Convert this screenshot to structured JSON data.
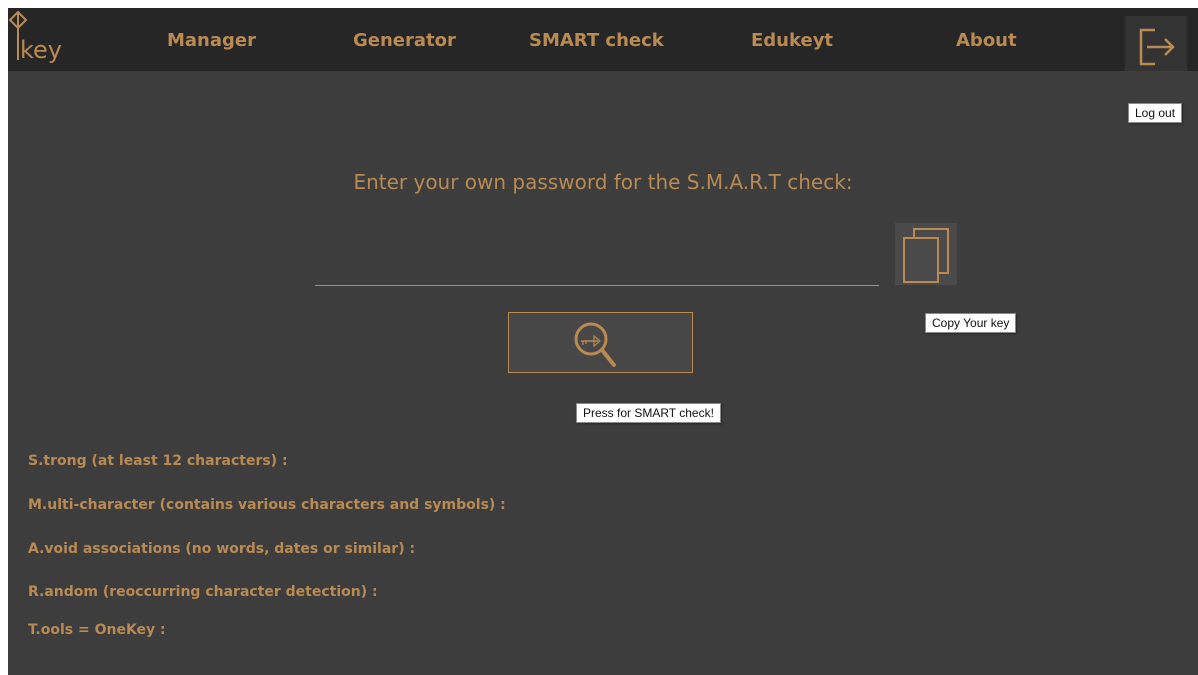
{
  "navbar": {
    "logo_text": "key",
    "items": [
      {
        "label": "Manager"
      },
      {
        "label": "Generator"
      },
      {
        "label": "SMART check"
      },
      {
        "label": "Edukeyt"
      },
      {
        "label": "About"
      }
    ],
    "logout_icon": "logout-icon",
    "logout_tooltip": "Log out"
  },
  "main": {
    "heading": "Enter your own password for the S.M.A.R.T check:",
    "password_input": {
      "value": "",
      "placeholder": ""
    },
    "copy_icon": "copy-icon",
    "copy_tooltip": "Copy Your key",
    "check_icon": "magnifier-key-icon",
    "check_tooltip": "Press for SMART check!"
  },
  "criteria": [
    {
      "label": "S.trong (at least 12 characters) :"
    },
    {
      "label": "M.ulti-character (contains various characters and symbols)  :"
    },
    {
      "label": "A.void associations (no words, dates or similar) :"
    },
    {
      "label": "R.andom (reoccurring character detection) :"
    },
    {
      "label": "T.ools = OneKey :"
    }
  ],
  "colors": {
    "accent": "#b98a52",
    "background": "#3d3d3d",
    "navbar": "#262626"
  }
}
